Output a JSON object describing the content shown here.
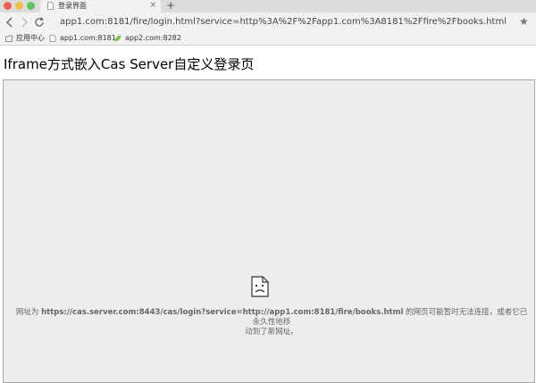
{
  "tab": {
    "title": "登录界面",
    "close": "×"
  },
  "new_tab": "+",
  "address_bar": {
    "url": "app1.com:8181/fire/login.html?service=http%3A%2F%2Fapp1.com%3A8181%2Ffire%2Fbooks.html"
  },
  "bookmarks": [
    {
      "label": "应用中心",
      "icon": "apps-icon"
    },
    {
      "label": "app1.com:8181",
      "icon": "page-icon"
    },
    {
      "label": "app2.com:8282",
      "icon": "leaf-icon"
    }
  ],
  "page": {
    "heading": "Iframe方式嵌入Cas Server自定义登录页",
    "error": {
      "prefix": "网址为 ",
      "url": "https://cas.server.com:8443/cas/login?service=http://app1.com:8181/fire/books.html",
      "suffix": " 的网页可能暂时无法连接，或者它已永久性地移",
      "line2": "动到了新网址。"
    }
  },
  "colors": {
    "tabstrip": "#dcdcdc",
    "toolbar": "#f2f2f2",
    "iframe_bg": "#ededed",
    "error_text": "#666666"
  }
}
